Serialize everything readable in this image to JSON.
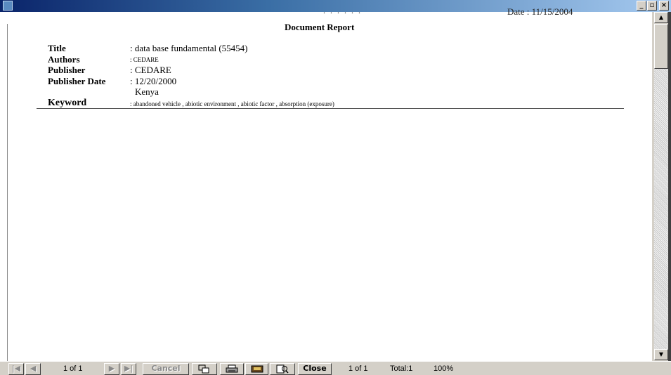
{
  "window": {
    "minimize_glyph": "_",
    "restore_glyph": "▫",
    "close_glyph": "×"
  },
  "report": {
    "dots": ". . . . . .",
    "date_text": "Date : 11/15/2004",
    "title": "Document Report",
    "fields": [
      {
        "label": "Title",
        "value": ": data base fundamental (55454)"
      },
      {
        "label": "Authors",
        "value": ": CEDARE"
      },
      {
        "label": "Publisher",
        "value": ": CEDARE"
      },
      {
        "label": "Publisher Date",
        "value": ": 12/20/2000"
      },
      {
        "label": "",
        "value": "Kenya"
      },
      {
        "label": "Keyword",
        "value": ":   abandoned vehicle  ,  abiotic environment  ,  abiotic factor  ,  absorption (exposure)"
      }
    ]
  },
  "toolbar": {
    "first_glyph": "|◀",
    "prev_glyph": "◀",
    "page_indicator": "1 of 1",
    "next_glyph": "▶",
    "last_glyph": "▶|",
    "cancel_label": "Cancel",
    "close_label": "Close",
    "page_count": "1 of 1",
    "total": "Total:1",
    "zoom": "100%"
  },
  "icons": [
    "app-icon",
    "export-icon",
    "print-icon",
    "printer-setup-icon",
    "search-icon"
  ]
}
